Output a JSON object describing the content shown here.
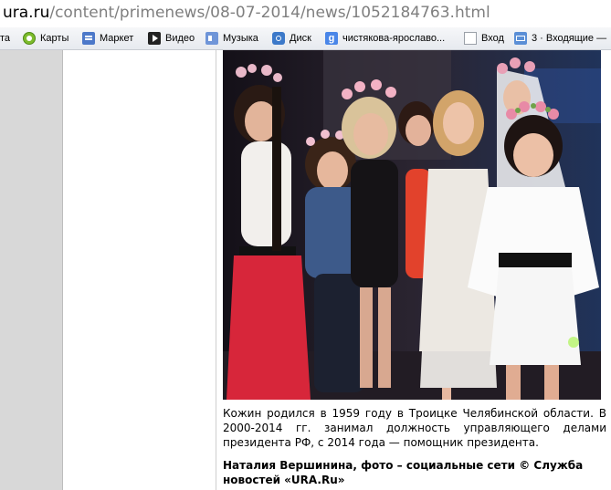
{
  "browser": {
    "url_host": "ura.ru",
    "url_path": "/content/primenews/08-07-2014/news/1052184763.html",
    "bookmarks": [
      {
        "label": "та",
        "icon": "none"
      },
      {
        "label": "Карты",
        "icon": "maps-icon"
      },
      {
        "label": "Маркет",
        "icon": "market-icon"
      },
      {
        "label": "Видео",
        "icon": "video-icon"
      },
      {
        "label": "Музыка",
        "icon": "music-icon"
      },
      {
        "label": "Диск",
        "icon": "disk-icon"
      },
      {
        "label": "чистякова-ярославо...",
        "icon": "google-icon"
      },
      {
        "label": "Вход",
        "icon": "page-icon"
      },
      {
        "label": "3 · Входящие —",
        "icon": "mail-icon"
      }
    ]
  },
  "article": {
    "caption": "Кожин родился в 1959 году в Троицке Челябинской области. В 2000-2014 гг. занимал должность управляющего делами президента РФ, с 2014 года — помощник президента.",
    "credit": "Наталия Вершинина, фото – социальные сети © Служба новостей «URA.Ru»"
  },
  "colors": {
    "url_path": "#7f7f7f",
    "sidebar": "#d8d8d8",
    "photo_bg": "#1c1722"
  }
}
